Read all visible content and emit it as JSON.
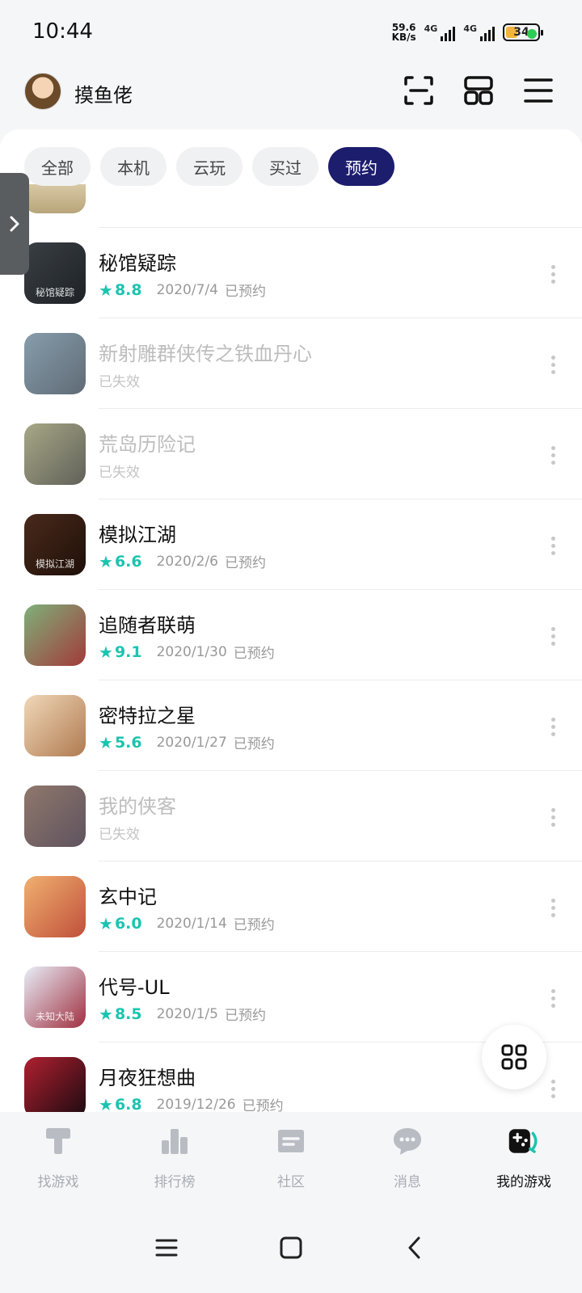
{
  "status_bar": {
    "time": "10:44",
    "net_speed_value": "59.6",
    "net_speed_unit": "KB/s",
    "signal1_label": "4G",
    "signal2_label": "4G",
    "battery": "34"
  },
  "header": {
    "username": "摸鱼佬",
    "icons": [
      "scan-icon",
      "grid-layout-icon",
      "menu-icon"
    ]
  },
  "filters": [
    {
      "label": "全部",
      "active": false
    },
    {
      "label": "本机",
      "active": false
    },
    {
      "label": "云玩",
      "active": false
    },
    {
      "label": "买过",
      "active": false
    },
    {
      "label": "预约",
      "active": true
    }
  ],
  "games": [
    {
      "title": "秘馆疑踪",
      "score": "8.8",
      "date": "2020/7/4",
      "status": "已预约",
      "expired": false,
      "thumb_text": "秘馆疑踪",
      "colors": [
        "#3a3f44",
        "#1d2226"
      ]
    },
    {
      "title": "新射雕群侠传之铁血丹心",
      "score": "",
      "date": "",
      "status": "已失效",
      "expired": true,
      "thumb_text": "",
      "colors": [
        "#5f7c90",
        "#2a3a48"
      ]
    },
    {
      "title": "荒岛历险记",
      "score": "",
      "date": "",
      "status": "已失效",
      "expired": true,
      "thumb_text": "",
      "colors": [
        "#8a8a5e",
        "#2c2c22"
      ]
    },
    {
      "title": "模拟江湖",
      "score": "6.6",
      "date": "2020/2/6",
      "status": "已预约",
      "expired": false,
      "thumb_text": "模拟江湖",
      "colors": [
        "#4a2a1c",
        "#1e0f08"
      ]
    },
    {
      "title": "追随者联萌",
      "score": "9.1",
      "date": "2020/1/30",
      "status": "已预约",
      "expired": false,
      "thumb_text": "",
      "colors": [
        "#7fb07a",
        "#a23a3a"
      ]
    },
    {
      "title": "密特拉之星",
      "score": "5.6",
      "date": "2020/1/27",
      "status": "已预约",
      "expired": false,
      "thumb_text": "",
      "colors": [
        "#f0d8b8",
        "#b07a50"
      ]
    },
    {
      "title": "我的侠客",
      "score": "",
      "date": "",
      "status": "已失效",
      "expired": true,
      "thumb_text": "",
      "colors": [
        "#6a4a3a",
        "#2a1a2a"
      ]
    },
    {
      "title": "玄中记",
      "score": "6.0",
      "date": "2020/1/14",
      "status": "已预约",
      "expired": false,
      "thumb_text": "",
      "colors": [
        "#f0b070",
        "#c0503a"
      ]
    },
    {
      "title": "代号-UL",
      "score": "8.5",
      "date": "2020/1/5",
      "status": "已预约",
      "expired": false,
      "thumb_text": "未知大陆",
      "colors": [
        "#e8eef8",
        "#a03040"
      ]
    },
    {
      "title": "月夜狂想曲",
      "score": "6.8",
      "date": "2019/12/26",
      "status": "已预约",
      "expired": false,
      "thumb_text": "",
      "colors": [
        "#b02030",
        "#1a0a10"
      ]
    }
  ],
  "bottom_nav": [
    {
      "label": "找游戏",
      "icon": "find-game-icon",
      "active": false
    },
    {
      "label": "排行榜",
      "icon": "ranking-icon",
      "active": false
    },
    {
      "label": "社区",
      "icon": "community-icon",
      "active": false
    },
    {
      "label": "消息",
      "icon": "message-icon",
      "active": false
    },
    {
      "label": "我的游戏",
      "icon": "my-games-icon",
      "active": true
    }
  ],
  "colors": {
    "accent_teal": "#1bc4b0",
    "active_chip": "#1d1d6e"
  }
}
